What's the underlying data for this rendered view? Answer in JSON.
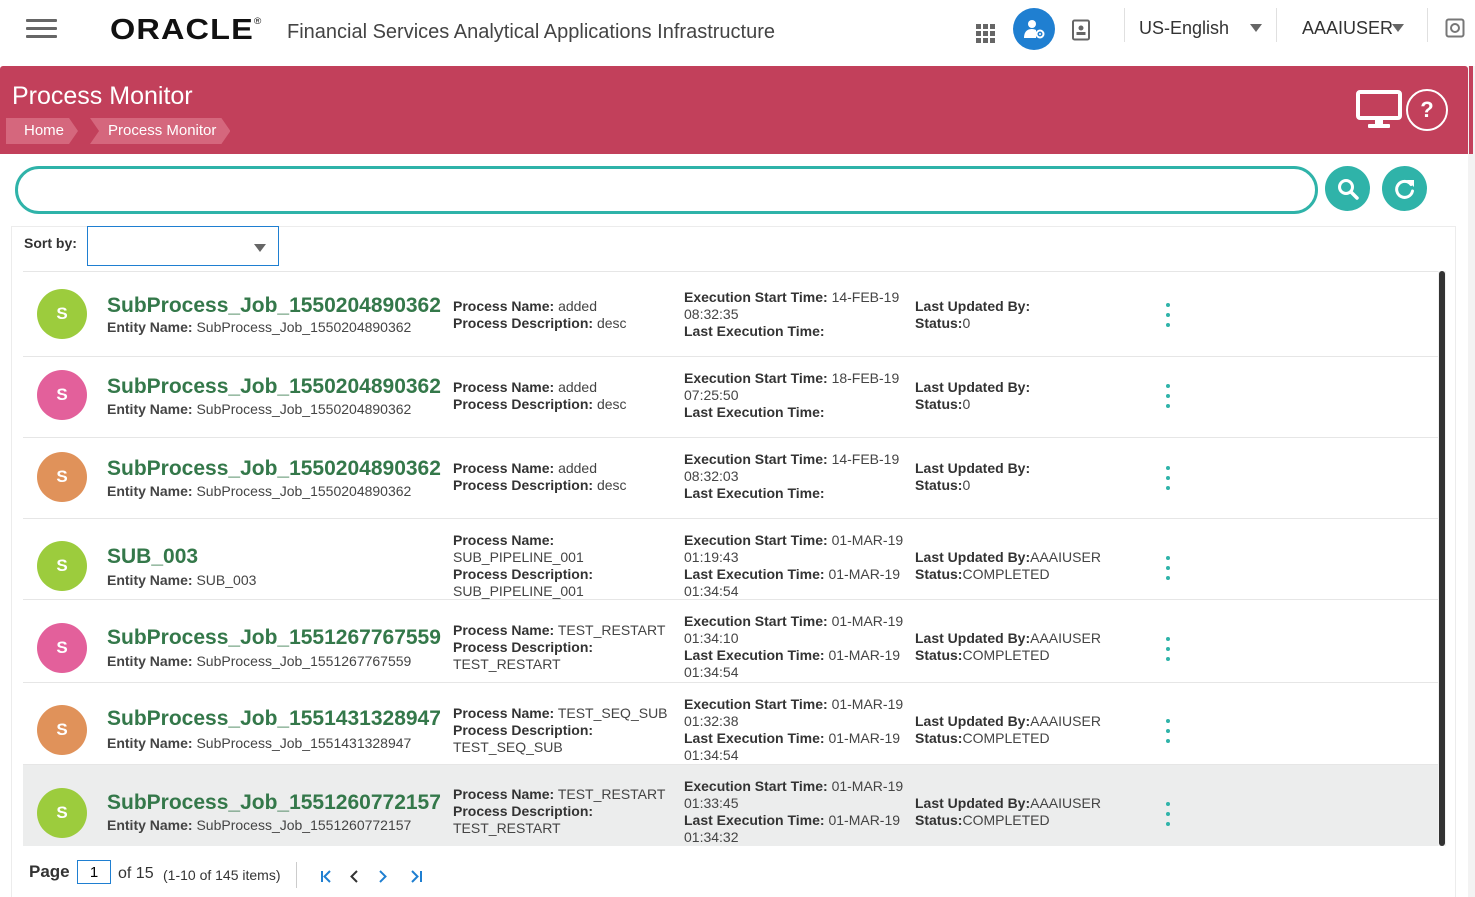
{
  "header": {
    "logo": "ORACLE",
    "trademark": "®",
    "app_title": "Financial Services Analytical Applications Infrastructure",
    "language": "US-English",
    "user": "AAAIUSER"
  },
  "banner": {
    "title": "Process Monitor",
    "breadcrumbs": [
      "Home",
      "Process Monitor"
    ],
    "help": "?"
  },
  "search": {
    "value": "",
    "placeholder": ""
  },
  "sort": {
    "label": "Sort by:",
    "value": ""
  },
  "labels": {
    "entity": "Entity Name:",
    "process_name": "Process Name:",
    "process_desc": "Process Description:",
    "exec_start": "Execution Start Time:",
    "last_exec": "Last Execution Time:",
    "last_updated": "Last Updated By:",
    "status": "Status:"
  },
  "colors": {
    "accent": "#c2405b",
    "teal": "#2fb3a9",
    "green": "#34784a",
    "avatar_green": "#9ccc3d",
    "avatar_pink": "#e3609b",
    "avatar_orange": "#e0925a"
  },
  "rows": [
    {
      "initial": "S",
      "color": "#9ccc3d",
      "name": "SubProcess_Job_1550204890362",
      "entity": "SubProcess_Job_1550204890362",
      "process_name": "added",
      "process_desc": "desc",
      "exec_start": "14-FEB-19 08:32:35",
      "last_exec": "",
      "last_updated": "",
      "status": "0"
    },
    {
      "initial": "S",
      "color": "#e3609b",
      "name": "SubProcess_Job_1550204890362",
      "entity": "SubProcess_Job_1550204890362",
      "process_name": "added",
      "process_desc": "desc",
      "exec_start": "18-FEB-19 07:25:50",
      "last_exec": "",
      "last_updated": "",
      "status": "0"
    },
    {
      "initial": "S",
      "color": "#e0925a",
      "name": "SubProcess_Job_1550204890362",
      "entity": "SubProcess_Job_1550204890362",
      "process_name": "added",
      "process_desc": "desc",
      "exec_start": "14-FEB-19 08:32:03",
      "last_exec": "",
      "last_updated": "",
      "status": "0"
    },
    {
      "initial": "S",
      "color": "#9ccc3d",
      "name": "SUB_003",
      "entity": "SUB_003",
      "process_name": "SUB_PIPELINE_001",
      "process_desc": "SUB_PIPELINE_001",
      "exec_start": "01-MAR-19 01:19:43",
      "last_exec": "01-MAR-19 01:34:54",
      "last_updated": "AAAIUSER",
      "status": "COMPLETED"
    },
    {
      "initial": "S",
      "color": "#e3609b",
      "name": "SubProcess_Job_1551267767559",
      "entity": "SubProcess_Job_1551267767559",
      "process_name": "TEST_RESTART",
      "process_desc": "TEST_RESTART",
      "exec_start": "01-MAR-19 01:34:10",
      "last_exec": "01-MAR-19 01:34:54",
      "last_updated": "AAAIUSER",
      "status": "COMPLETED"
    },
    {
      "initial": "S",
      "color": "#e0925a",
      "name": "SubProcess_Job_1551431328947",
      "entity": "SubProcess_Job_1551431328947",
      "process_name": "TEST_SEQ_SUB",
      "process_desc": "TEST_SEQ_SUB",
      "exec_start": "01-MAR-19 01:32:38",
      "last_exec": "01-MAR-19 01:34:54",
      "last_updated": "AAAIUSER",
      "status": "COMPLETED"
    },
    {
      "initial": "S",
      "color": "#9ccc3d",
      "name": "SubProcess_Job_1551260772157",
      "entity": "SubProcess_Job_1551260772157",
      "process_name": "TEST_RESTART",
      "process_desc": "TEST_RESTART",
      "exec_start": "01-MAR-19 01:33:45",
      "last_exec": "01-MAR-19 01:34:32",
      "last_updated": "AAAIUSER",
      "status": "COMPLETED"
    }
  ],
  "pager": {
    "label": "Page",
    "current": "1",
    "of": "of 15",
    "items": "(1-10 of 145 items)"
  }
}
